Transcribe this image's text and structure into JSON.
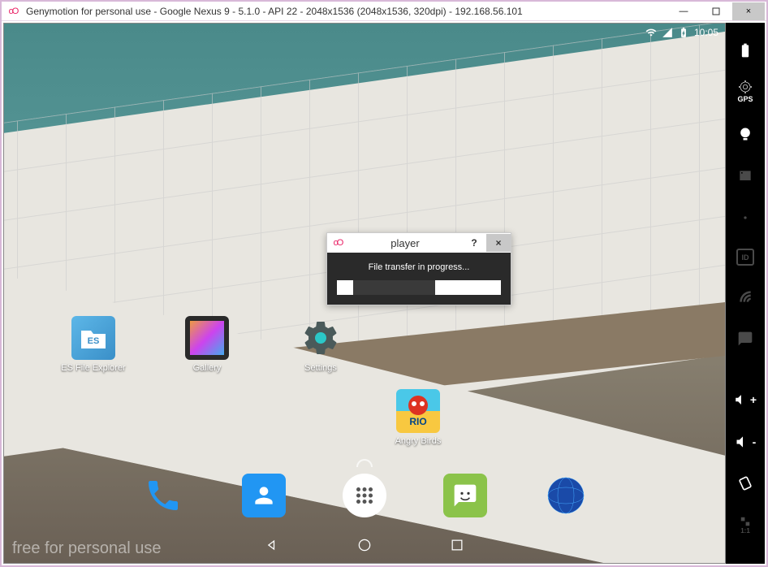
{
  "window": {
    "title": "Genymotion for personal use - Google Nexus 9 - 5.1.0 - API 22 - 2048x1536 (2048x1536, 320dpi) - 192.168.56.101"
  },
  "status": {
    "time": "10:05"
  },
  "apps": {
    "es": "ES File Explorer",
    "gallery": "Gallery",
    "settings": "Settings",
    "angrybirds": "Angry Birds"
  },
  "dialog": {
    "title": "player",
    "message": "File transfer in progress...",
    "help": "?",
    "close": "×"
  },
  "watermark": "free for personal use",
  "sidebar": {
    "gps": "GPS",
    "id": "ID",
    "scale": "1:1"
  },
  "titlebar_buttons": {
    "min": "—",
    "close": "×"
  }
}
